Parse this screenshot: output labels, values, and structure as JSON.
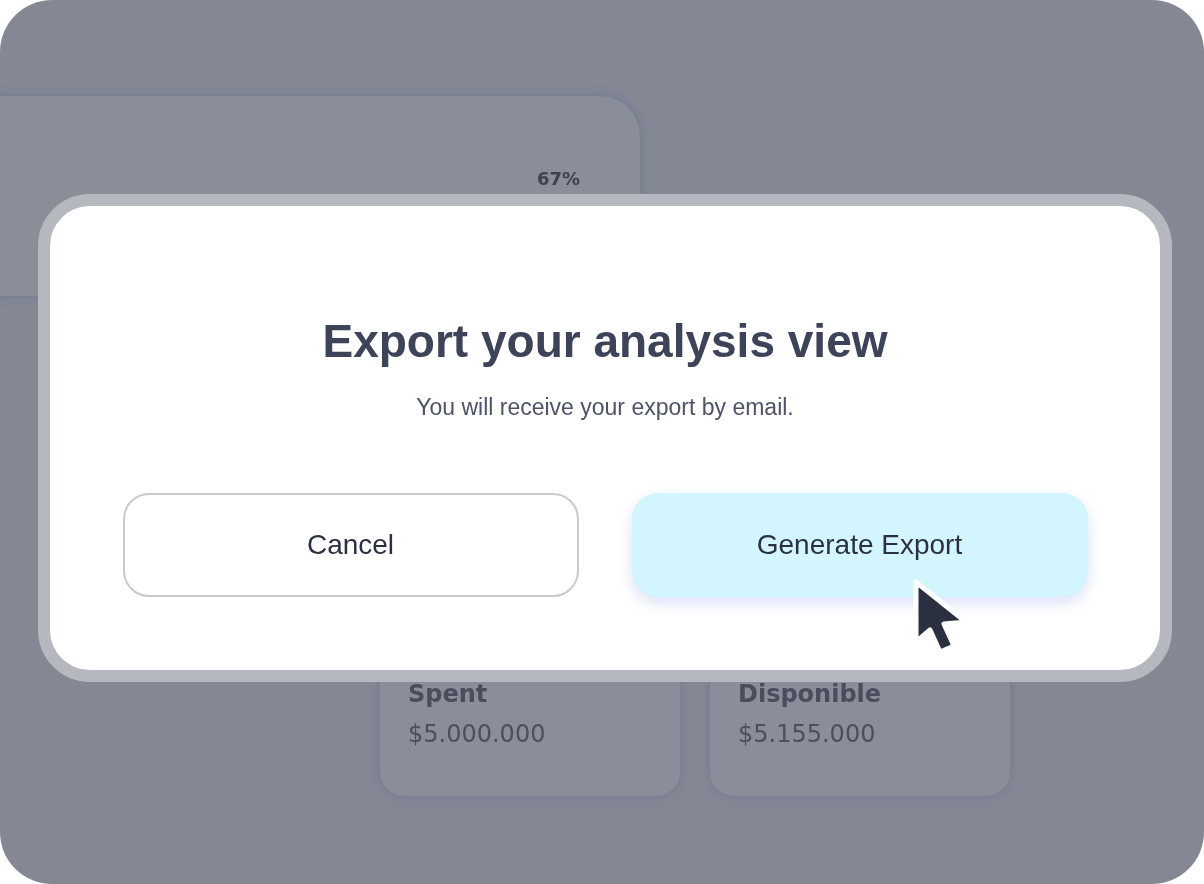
{
  "background": {
    "progress_label": "67%",
    "cards": [
      {
        "label": "Spent",
        "amount": "$5.000.000"
      },
      {
        "label": "Disponible",
        "amount": "$5.155.000"
      }
    ]
  },
  "dialog": {
    "title": "Export your analysis view",
    "message": "You will receive your export by email.",
    "buttons": [
      {
        "label": "Cancel",
        "kind": "secondary"
      },
      {
        "label": "Generate Export",
        "kind": "primary"
      }
    ]
  }
}
